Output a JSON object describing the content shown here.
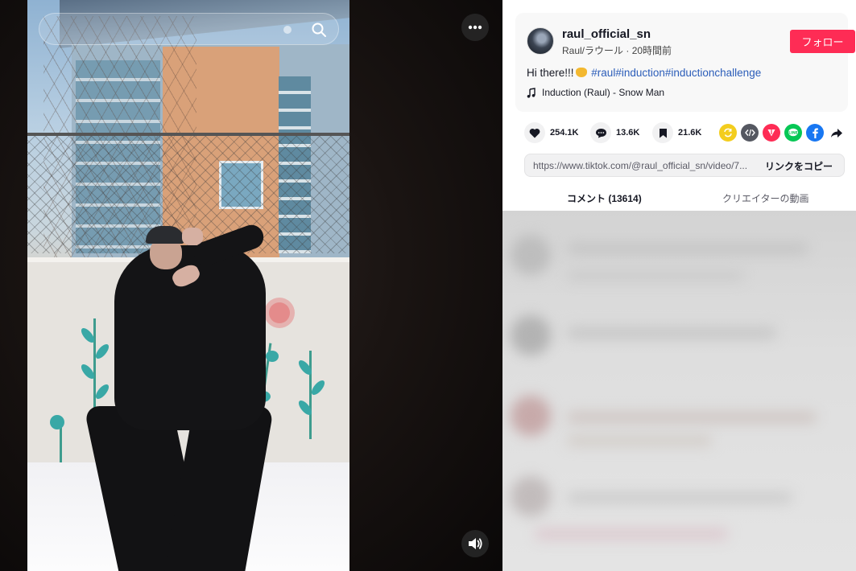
{
  "video": {
    "search_placeholder": "",
    "more_icon": "ellipsis-icon",
    "volume_icon": "speaker-icon"
  },
  "post": {
    "username": "raul_official_sn",
    "display_name": "Raul/ラウール",
    "separator": " · ",
    "posted_time": "20時間前",
    "follow_label": "フォロー",
    "caption_text": "Hi there!!!",
    "hashtags": "#raul#induction#inductionchallenge",
    "music": "Induction (Raul) - Snow Man"
  },
  "stats": {
    "likes": "254.1K",
    "comments": "13.6K",
    "saves": "21.6K"
  },
  "share_icons": [
    "repost-icon",
    "embed-icon",
    "send-icon",
    "line-icon",
    "facebook-icon",
    "share-arrow-icon"
  ],
  "link": {
    "url": "https://www.tiktok.com/@raul_official_sn/video/7...",
    "copy_label": "リンクをコピー"
  },
  "tabs": {
    "comments_label": "コメント (13614)",
    "creator_label": "クリエイターの動画"
  },
  "colors": {
    "follow": "#fe2c55",
    "hashtag": "#2b5db9",
    "repost": "#f3cd1e",
    "embed": "#555861",
    "send": "#fe2c55",
    "line": "#06c755",
    "facebook": "#1877f2"
  }
}
